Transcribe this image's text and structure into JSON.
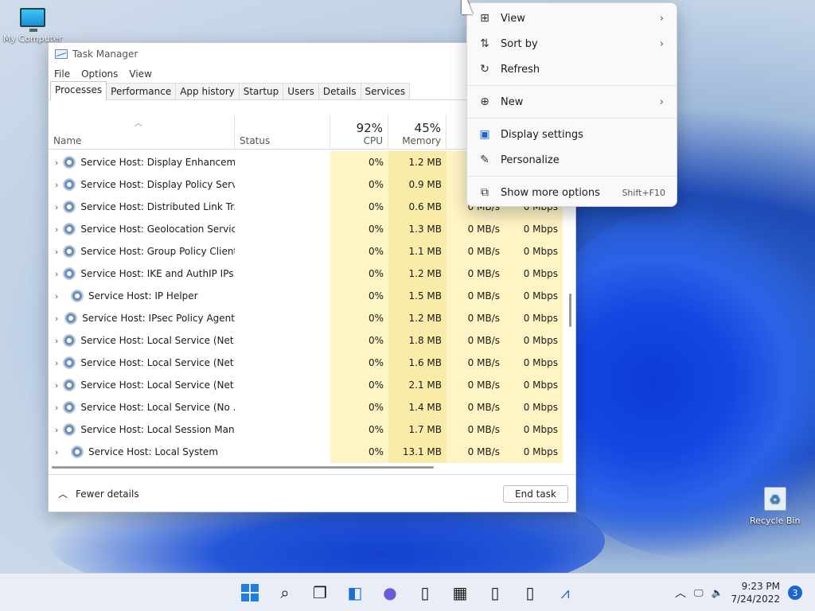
{
  "desktop": {
    "icons": [
      {
        "label": "My Computer",
        "icon": "computer-icon"
      },
      {
        "label": "Recycle Bin",
        "icon": "recycle-bin-icon"
      }
    ]
  },
  "task_manager": {
    "title": "Task Manager",
    "menu": [
      "File",
      "Options",
      "View"
    ],
    "tabs": [
      "Processes",
      "Performance",
      "App history",
      "Startup",
      "Users",
      "Details",
      "Services"
    ],
    "active_tab": "Processes",
    "columns": {
      "name": "Name",
      "status": "Status",
      "cpu": {
        "percent": "92%",
        "label": "CPU"
      },
      "memory": {
        "percent": "45%",
        "label": "Memory"
      }
    },
    "rows": [
      {
        "name": "Service Host: Display Enhancem...",
        "cpu": "0%",
        "memory": "1.2 MB",
        "disk": "",
        "network": ""
      },
      {
        "name": "Service Host: Display Policy Serv...",
        "cpu": "0%",
        "memory": "0.9 MB",
        "disk": "",
        "network": ""
      },
      {
        "name": "Service Host: Distributed Link Tr...",
        "cpu": "0%",
        "memory": "0.6 MB",
        "disk": "0 MB/s",
        "network": "0 Mbps"
      },
      {
        "name": "Service Host: Geolocation Service",
        "cpu": "0%",
        "memory": "1.3 MB",
        "disk": "0 MB/s",
        "network": "0 Mbps"
      },
      {
        "name": "Service Host: Group Policy Client",
        "cpu": "0%",
        "memory": "1.1 MB",
        "disk": "0 MB/s",
        "network": "0 Mbps"
      },
      {
        "name": "Service Host: IKE and AuthIP IPs...",
        "cpu": "0%",
        "memory": "1.2 MB",
        "disk": "0 MB/s",
        "network": "0 Mbps"
      },
      {
        "name": "Service Host: IP Helper",
        "cpu": "0%",
        "memory": "1.5 MB",
        "disk": "0 MB/s",
        "network": "0 Mbps"
      },
      {
        "name": "Service Host: IPsec Policy Agent",
        "cpu": "0%",
        "memory": "1.2 MB",
        "disk": "0 MB/s",
        "network": "0 Mbps"
      },
      {
        "name": "Service Host: Local Service (Net...",
        "cpu": "0%",
        "memory": "1.8 MB",
        "disk": "0 MB/s",
        "network": "0 Mbps"
      },
      {
        "name": "Service Host: Local Service (Net...",
        "cpu": "0%",
        "memory": "1.6 MB",
        "disk": "0 MB/s",
        "network": "0 Mbps"
      },
      {
        "name": "Service Host: Local Service (Net...",
        "cpu": "0%",
        "memory": "2.1 MB",
        "disk": "0 MB/s",
        "network": "0 Mbps"
      },
      {
        "name": "Service Host: Local Service (No ...",
        "cpu": "0%",
        "memory": "1.4 MB",
        "disk": "0 MB/s",
        "network": "0 Mbps"
      },
      {
        "name": "Service Host: Local Session Man...",
        "cpu": "0%",
        "memory": "1.7 MB",
        "disk": "0 MB/s",
        "network": "0 Mbps"
      },
      {
        "name": "Service Host: Local System",
        "cpu": "0%",
        "memory": "13.1 MB",
        "disk": "0 MB/s",
        "network": "0 Mbps"
      }
    ],
    "footer": {
      "fewer_details": "Fewer details",
      "end_task": "End task"
    }
  },
  "context_menu": {
    "items": [
      {
        "label": "View",
        "icon": "grid-view-icon",
        "submenu": true
      },
      {
        "label": "Sort by",
        "icon": "sort-icon",
        "submenu": true
      },
      {
        "label": "Refresh",
        "icon": "refresh-icon",
        "submenu": false
      },
      {
        "label": "New",
        "icon": "new-plus-icon",
        "submenu": true
      },
      {
        "label": "Display settings",
        "icon": "display-settings-icon",
        "submenu": false
      },
      {
        "label": "Personalize",
        "icon": "personalize-brush-icon",
        "submenu": false
      },
      {
        "label": "Show more options",
        "icon": "show-more-icon",
        "shortcut": "Shift+F10"
      }
    ]
  },
  "taskbar": {
    "apps": [
      "start-icon",
      "search-icon",
      "task-view-icon",
      "widgets-icon",
      "chat-icon",
      "file-icon",
      "store-icon",
      "file-icon",
      "file-icon",
      "task-manager-icon"
    ],
    "clock": {
      "time": "9:23 PM",
      "date": "7/24/2022"
    },
    "notifications": "3"
  },
  "colors": {
    "cpu_fill": "#fff4c4",
    "memory_fill": "#f9eca8",
    "accent": "#1a66d1"
  }
}
